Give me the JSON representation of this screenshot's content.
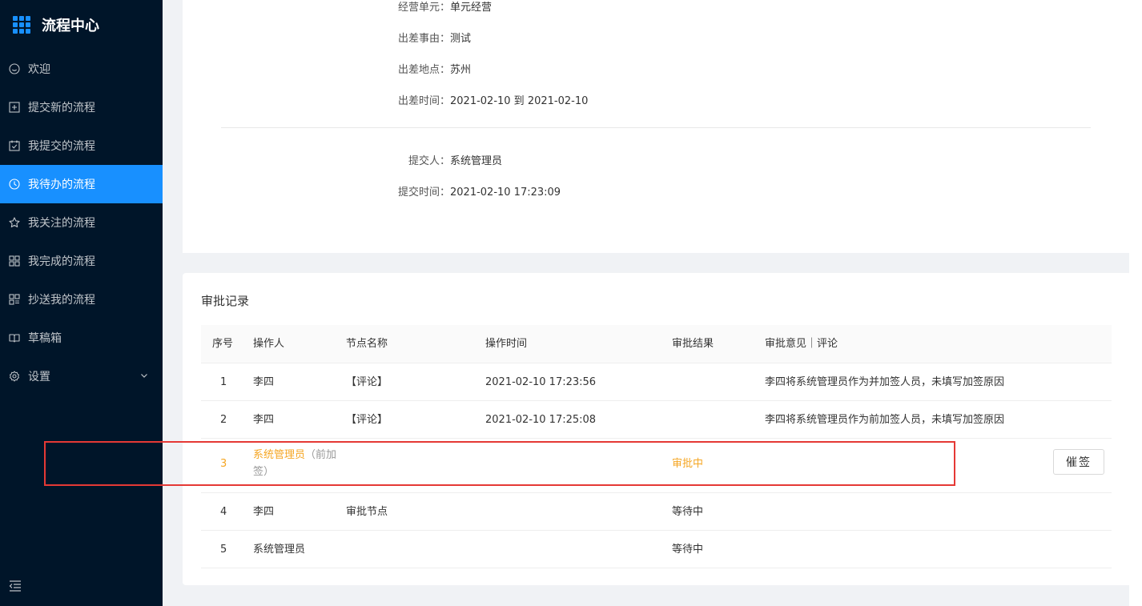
{
  "app": {
    "title": "流程中心"
  },
  "sidebar": {
    "items": [
      {
        "label": "欢迎",
        "icon": "smile-icon"
      },
      {
        "label": "提交新的流程",
        "icon": "plus-square-icon"
      },
      {
        "label": "我提交的流程",
        "icon": "check-square-icon"
      },
      {
        "label": "我待办的流程",
        "icon": "clock-icon"
      },
      {
        "label": "我关注的流程",
        "icon": "star-icon"
      },
      {
        "label": "我完成的流程",
        "icon": "appstore-icon"
      },
      {
        "label": "抄送我的流程",
        "icon": "copy-icon"
      },
      {
        "label": "草稿箱",
        "icon": "book-icon"
      },
      {
        "label": "设置",
        "icon": "gear-icon"
      }
    ],
    "active_index": 3
  },
  "detail": {
    "unit_label": "经营单元：",
    "unit_value": "单元经营",
    "reason_label": "出差事由：",
    "reason_value": "测试",
    "place_label": "出差地点：",
    "place_value": "苏州",
    "time_label": "出差时间：",
    "time_value": "2021-02-10 到 2021-02-10",
    "submitter_label": "提交人：",
    "submitter_value": "系统管理员",
    "submit_time_label": "提交时间：",
    "submit_time_value": "2021-02-10 17:23:09"
  },
  "records": {
    "title": "审批记录",
    "headers": {
      "idx": "序号",
      "operator": "操作人",
      "node": "节点名称",
      "time": "操作时间",
      "result": "审批结果",
      "comment": "审批意见｜评论"
    },
    "rows": [
      {
        "idx": "1",
        "operator": "李四",
        "node": "【评论】",
        "time": "2021-02-10 17:23:56",
        "result": "",
        "comment": "李四将系统管理员作为并加签人员，未填写加签原因"
      },
      {
        "idx": "2",
        "operator": "李四",
        "node": "【评论】",
        "time": "2021-02-10 17:25:08",
        "result": "",
        "comment": "李四将系统管理员作为前加签人员，未填写加签原因"
      },
      {
        "idx": "3",
        "operator": "系统管理员",
        "operator_note": "（前加签）",
        "node": "",
        "time": "",
        "result": "审批中",
        "comment": "",
        "action": "催签"
      },
      {
        "idx": "4",
        "operator": "李四",
        "node": "审批节点",
        "time": "",
        "result": "等待中",
        "comment": ""
      },
      {
        "idx": "5",
        "operator": "系统管理员",
        "node": "",
        "time": "",
        "result": "等待中",
        "comment": ""
      }
    ]
  },
  "colors": {
    "sidebar_bg": "#001529",
    "active": "#1890ff",
    "pending": "#f5a623",
    "highlight": "#e53935"
  }
}
